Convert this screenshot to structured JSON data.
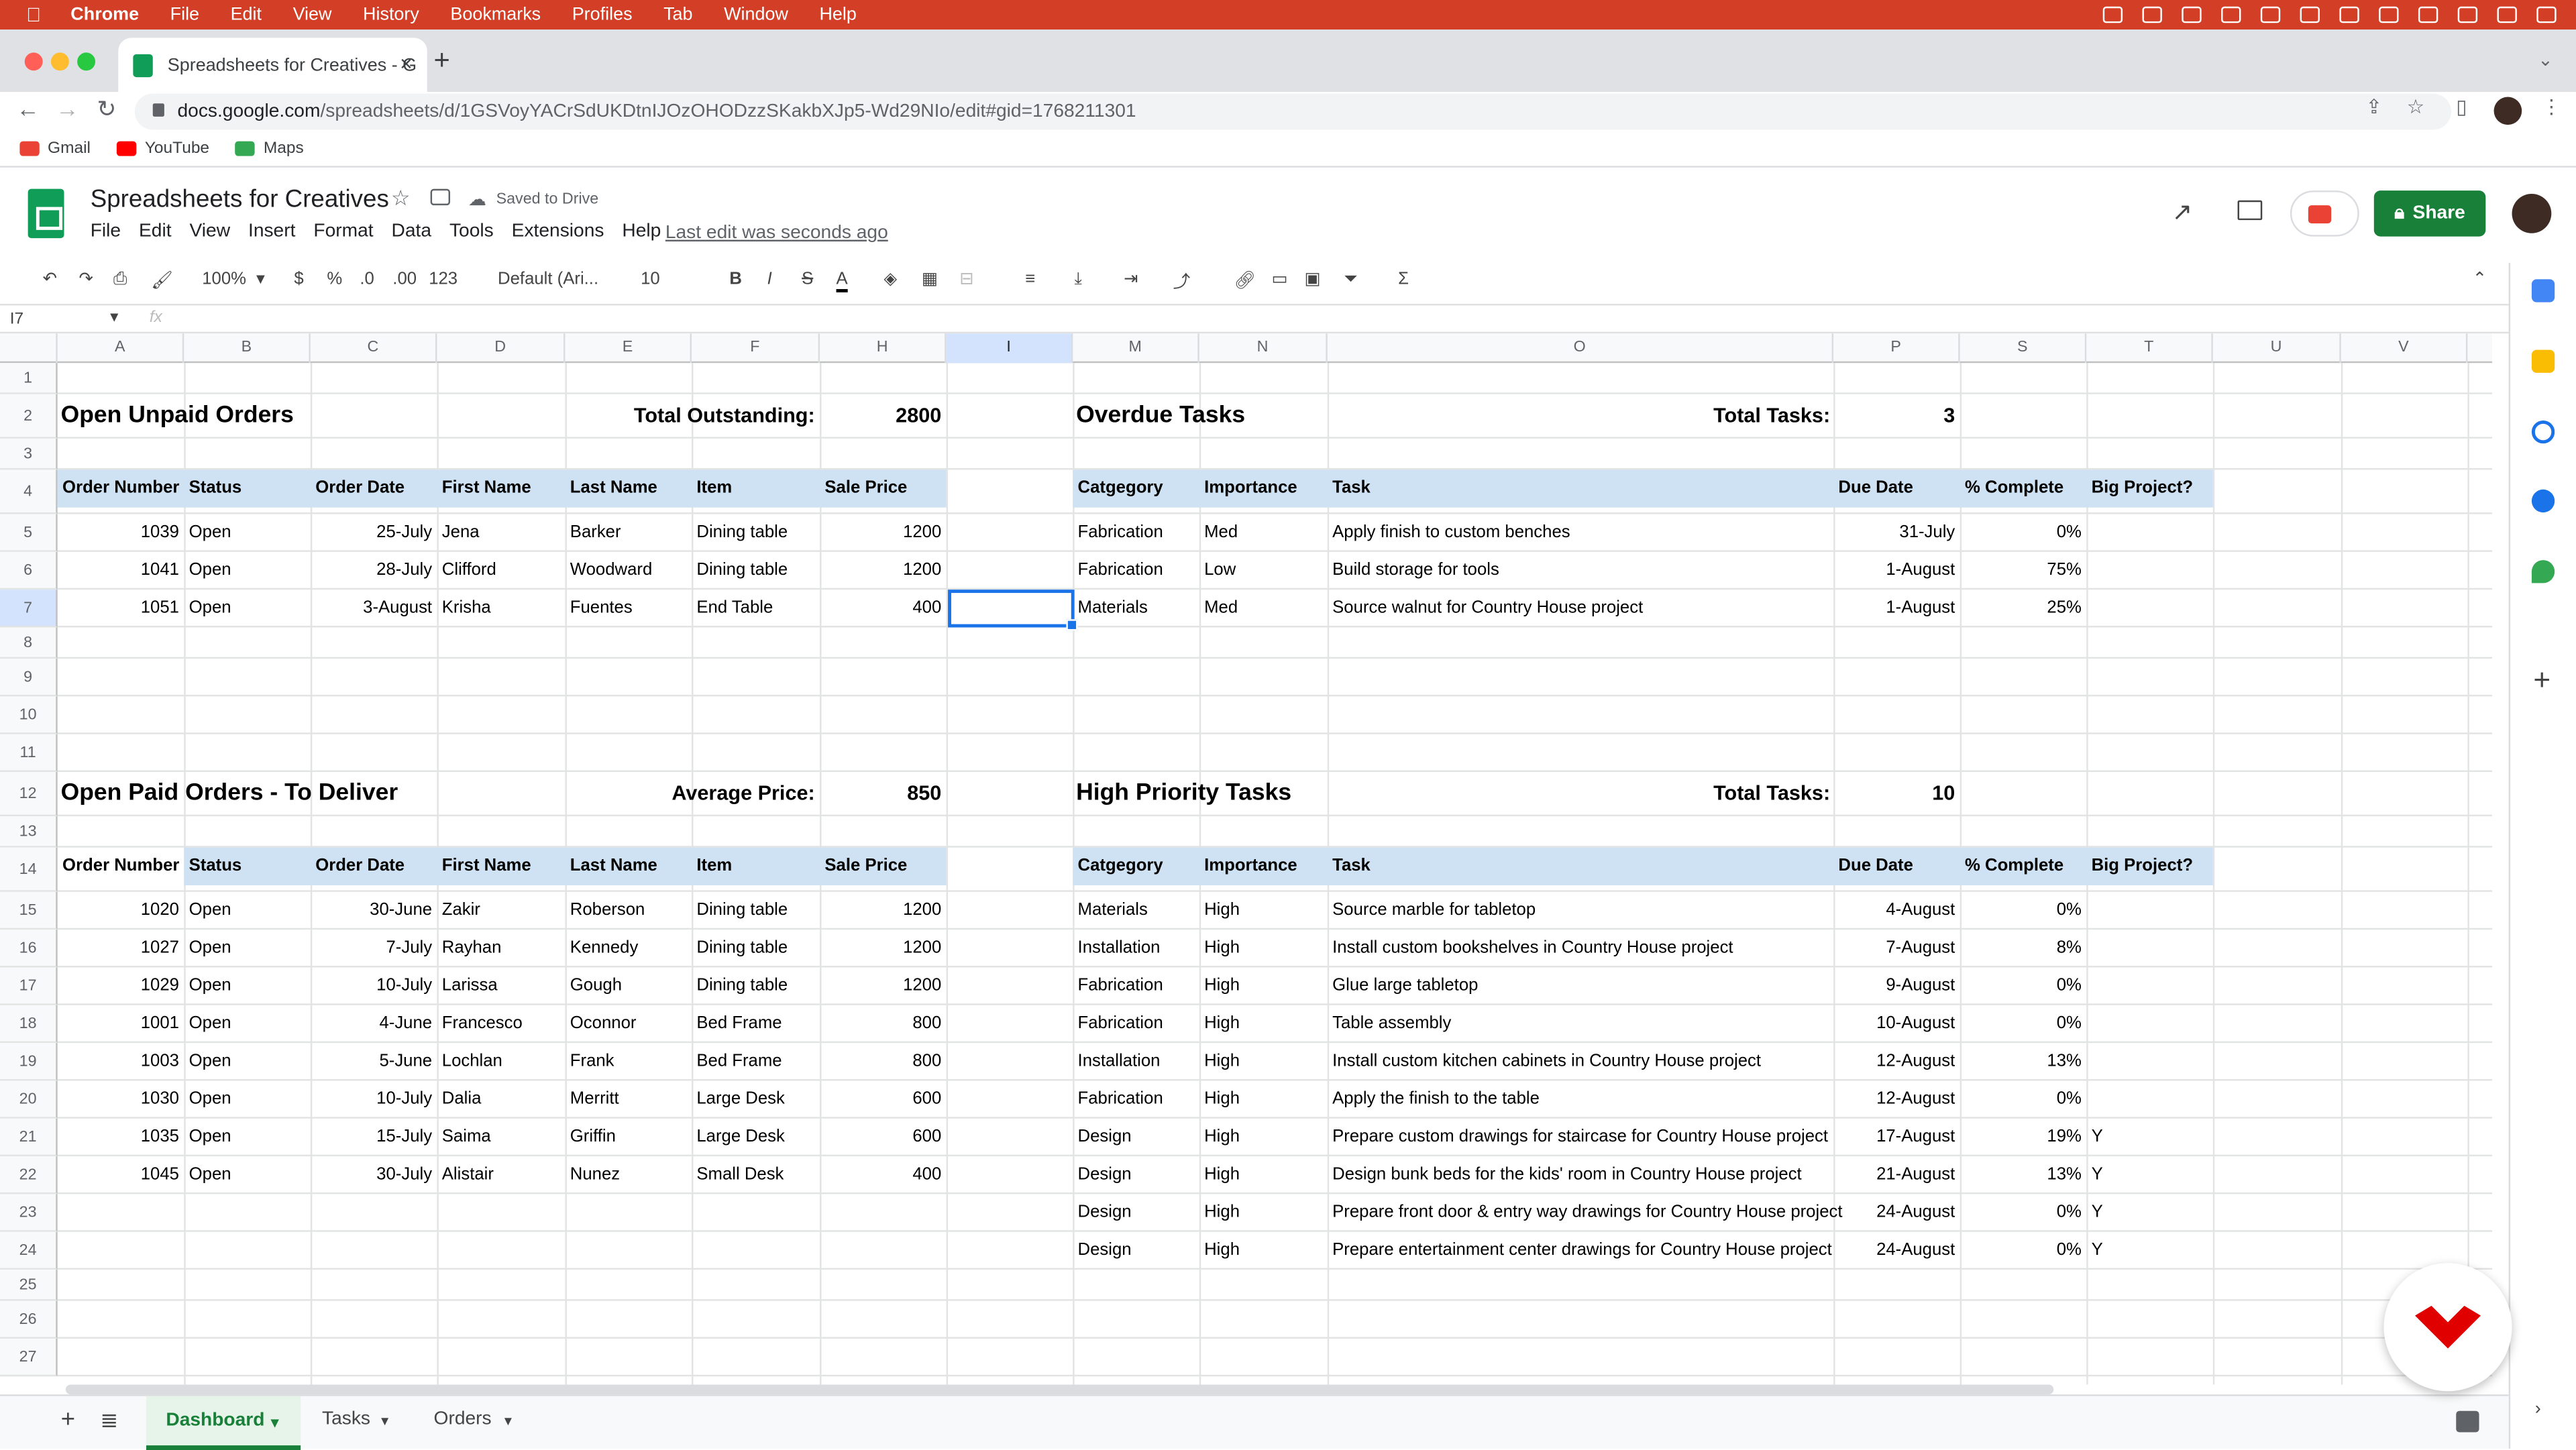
{
  "mac_menubar": {
    "app": "Chrome",
    "items": [
      "File",
      "Edit",
      "View",
      "History",
      "Bookmarks",
      "Profiles",
      "Tab",
      "Window",
      "Help"
    ]
  },
  "browser": {
    "tab_title": "Spreadsheets for Creatives - G",
    "url_host": "docs.google.com",
    "url_path": "/spreadsheets/d/1GSVoyYACrSdUKDtnIJOzOHODzzSKakbXJp5-Wd29NIo/edit#gid=1768211301",
    "bookmarks": [
      "Gmail",
      "YouTube",
      "Maps"
    ]
  },
  "sheets": {
    "title": "Spreadsheets for Creatives",
    "saved_status": "Saved to Drive",
    "menus": [
      "File",
      "Edit",
      "View",
      "Insert",
      "Format",
      "Data",
      "Tools",
      "Extensions",
      "Help"
    ],
    "last_edit": "Last edit was seconds ago",
    "share_label": "Share",
    "toolbar": {
      "zoom": "100%",
      "currency": "$",
      "percent": "%",
      "dec_less": ".0",
      "dec_more": ".00",
      "format": "123",
      "font": "Default (Ari...",
      "size": "10",
      "bold": "B",
      "italic": "I",
      "strike": "S",
      "text_color": "A"
    },
    "cell_ref": "I7",
    "fx": "fx",
    "columns": [
      "A",
      "B",
      "C",
      "D",
      "E",
      "F",
      "H",
      "I",
      "M",
      "N",
      "O",
      "P",
      "S",
      "T",
      "U",
      "V"
    ],
    "rows": [
      "1",
      "2",
      "3",
      "4",
      "5",
      "6",
      "7",
      "8",
      "9",
      "10",
      "11",
      "12",
      "13",
      "14",
      "15",
      "16",
      "17",
      "18",
      "19",
      "20",
      "21",
      "22",
      "23",
      "24",
      "25",
      "26",
      "27"
    ],
    "sheet_tabs": [
      "Dashboard",
      "Tasks",
      "Orders"
    ]
  },
  "unpaid": {
    "title": "Open Unpaid Orders",
    "total_label": "Total Outstanding:",
    "total_value": "2800",
    "headers": [
      "Order Number",
      "Status",
      "Order Date",
      "First Name",
      "Last Name",
      "Item",
      "Sale Price"
    ],
    "rows": [
      [
        "1039",
        "Open",
        "25-July",
        "Jena",
        "Barker",
        "Dining table",
        "1200"
      ],
      [
        "1041",
        "Open",
        "28-July",
        "Clifford",
        "Woodward",
        "Dining table",
        "1200"
      ],
      [
        "1051",
        "Open",
        "3-August",
        "Krisha",
        "Fuentes",
        "End Table",
        "400"
      ]
    ]
  },
  "overdue": {
    "title": "Overdue Tasks",
    "total_label": "Total Tasks:",
    "total_value": "3",
    "headers": [
      "Catgegory",
      "Importance",
      "Task",
      "Due Date",
      "% Complete",
      "Big Project?"
    ],
    "rows": [
      [
        "Fabrication",
        "Med",
        "Apply finish to custom benches",
        "31-July",
        "0%",
        ""
      ],
      [
        "Fabrication",
        "Low",
        "Build storage for tools",
        "1-August",
        "75%",
        ""
      ],
      [
        "Materials",
        "Med",
        "Source walnut for Country House project",
        "1-August",
        "25%",
        ""
      ]
    ]
  },
  "paid": {
    "title": "Open Paid Orders - To Deliver",
    "total_label": "Average Price:",
    "total_value": "850",
    "headers": [
      "Order Number",
      "Status",
      "Order Date",
      "First Name",
      "Last Name",
      "Item",
      "Sale Price"
    ],
    "rows": [
      [
        "1020",
        "Open",
        "30-June",
        "Zakir",
        "Roberson",
        "Dining table",
        "1200"
      ],
      [
        "1027",
        "Open",
        "7-July",
        "Rayhan",
        "Kennedy",
        "Dining table",
        "1200"
      ],
      [
        "1029",
        "Open",
        "10-July",
        "Larissa",
        "Gough",
        "Dining table",
        "1200"
      ],
      [
        "1001",
        "Open",
        "4-June",
        "Francesco",
        "Oconnor",
        "Bed Frame",
        "800"
      ],
      [
        "1003",
        "Open",
        "5-June",
        "Lochlan",
        "Frank",
        "Bed Frame",
        "800"
      ],
      [
        "1030",
        "Open",
        "10-July",
        "Dalia",
        "Merritt",
        "Large Desk",
        "600"
      ],
      [
        "1035",
        "Open",
        "15-July",
        "Saima",
        "Griffin",
        "Large Desk",
        "600"
      ],
      [
        "1045",
        "Open",
        "30-July",
        "Alistair",
        "Nunez",
        "Small Desk",
        "400"
      ]
    ]
  },
  "priority": {
    "title": "High Priority Tasks",
    "total_label": "Total Tasks:",
    "total_value": "10",
    "headers": [
      "Catgegory",
      "Importance",
      "Task",
      "Due Date",
      "% Complete",
      "Big Project?"
    ],
    "rows": [
      [
        "Materials",
        "High",
        "Source marble for tabletop",
        "4-August",
        "0%",
        ""
      ],
      [
        "Installation",
        "High",
        "Install custom bookshelves in Country House project",
        "7-August",
        "8%",
        ""
      ],
      [
        "Fabrication",
        "High",
        "Glue large tabletop",
        "9-August",
        "0%",
        ""
      ],
      [
        "Fabrication",
        "High",
        "Table assembly",
        "10-August",
        "0%",
        ""
      ],
      [
        "Installation",
        "High",
        "Install custom kitchen cabinets in Country House project",
        "12-August",
        "13%",
        ""
      ],
      [
        "Fabrication",
        "High",
        "Apply the finish to the table",
        "12-August",
        "0%",
        ""
      ],
      [
        "Design",
        "High",
        "Prepare custom drawings for staircase for Country House project",
        "17-August",
        "19%",
        "Y"
      ],
      [
        "Design",
        "High",
        "Design bunk beds for the kids' room in Country House project",
        "21-August",
        "13%",
        "Y"
      ],
      [
        "Design",
        "High",
        "Prepare front door & entry way drawings for Country House project",
        "24-August",
        "0%",
        "Y"
      ],
      [
        "Design",
        "High",
        "Prepare entertainment center drawings for Country House project",
        "24-August",
        "0%",
        "Y"
      ]
    ]
  }
}
